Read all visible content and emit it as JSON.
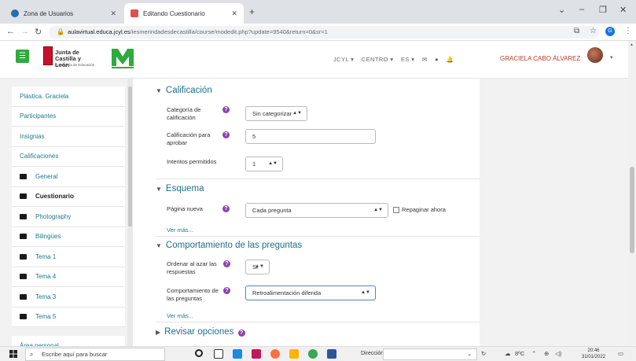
{
  "browser": {
    "tabs": [
      {
        "label": "Zona de Usuarios",
        "active": false
      },
      {
        "label": "Editando Cuestionario",
        "active": true
      }
    ],
    "url_host": "aulavirtual.educa.jcyl.es",
    "url_path": "/iesmerindadesdecastilla/course/modedit.php?update=9540&return=0&sr=1"
  },
  "header": {
    "logo_line1": "Junta de",
    "logo_line2": "Castilla y León",
    "logo_sub": "Consejería de Educación",
    "nav": [
      "JCYL ▾",
      "CENTRO ▾",
      "ES ▾"
    ],
    "user_name": "GRACIELA CABO ÁLVAREZ"
  },
  "sidebar": {
    "items": [
      {
        "label": "Plástica. Graciela",
        "folder": false,
        "bold": false
      },
      {
        "label": "Participantes",
        "folder": false,
        "bold": false
      },
      {
        "label": "Insignias",
        "folder": false,
        "bold": false
      },
      {
        "label": "Calificaciones",
        "folder": false,
        "bold": false
      },
      {
        "label": "General",
        "folder": true,
        "bold": false
      },
      {
        "label": "Cuestionario",
        "folder": true,
        "bold": true
      },
      {
        "label": "Photography",
        "folder": true,
        "bold": false
      },
      {
        "label": "Bilingües",
        "folder": true,
        "bold": false
      },
      {
        "label": "Tema 1",
        "folder": true,
        "bold": false
      },
      {
        "label": "Tema 4",
        "folder": true,
        "bold": false
      },
      {
        "label": "Tema 3",
        "folder": true,
        "bold": false
      },
      {
        "label": "Tema 5",
        "folder": true,
        "bold": false
      },
      {
        "label": "Área personal",
        "folder": false,
        "bold": false
      }
    ]
  },
  "form": {
    "calificacion": {
      "title": "Calificación",
      "categoria_label": "Categoría de calificación",
      "categoria_value": "Sin categorizar",
      "aprobar_label": "Calificación para aprobar",
      "aprobar_value": "5",
      "intentos_label": "Intentos permitidos",
      "intentos_value": "1"
    },
    "esquema": {
      "title": "Esquema",
      "pagina_label": "Página nueva",
      "pagina_value": "Cada pregunta",
      "repaginar_label": "Repaginar ahora",
      "vermas": "Ver más..."
    },
    "comportamiento": {
      "title": "Comportamiento de las preguntas",
      "ordenar_label": "Ordenar al azar las respuestas",
      "ordenar_value": "Sí",
      "comp_label": "Comportamiento de las preguntas",
      "comp_value": "Retroalimentación diferida",
      "vermas": "Ver más..."
    },
    "revisar": {
      "title": "Revisar opciones"
    }
  },
  "taskbar": {
    "search_placeholder": "Escribe aquí para buscar",
    "direccion": "Dirección",
    "weather": "8ºC",
    "time": "20:46",
    "date": "31/01/2022"
  },
  "colors": {
    "accent_green": "#2eaa3f",
    "link_teal": "#1f7a8c",
    "help_purple": "#8e44ad",
    "user_red": "#c0392b"
  }
}
